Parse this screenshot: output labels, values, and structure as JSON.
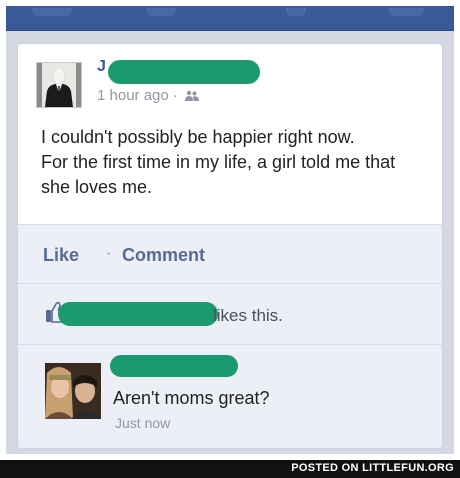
{
  "post": {
    "author_initial": "J",
    "timestamp": "1 hour ago",
    "separator": "·",
    "audience_icon": "friends-icon",
    "text_lines": [
      "I couldn't possibly be happier right now.",
      "For the first time in my life, a girl told me that",
      "she loves me."
    ]
  },
  "actions": {
    "like": "Like",
    "separator": "·",
    "comment": "Comment"
  },
  "likes": {
    "icon": "thumbs-up-icon",
    "suffix": "likes this."
  },
  "comment": {
    "text": "Aren't moms great?",
    "timestamp": "Just now"
  },
  "watermark": "POSTED ON LITTLEFUN.ORG",
  "colors": {
    "facebook_blue": "#3b5998",
    "link_blue": "#576b95",
    "redaction_green": "#1c9a6f",
    "feedback_bg": "#eceff5"
  }
}
